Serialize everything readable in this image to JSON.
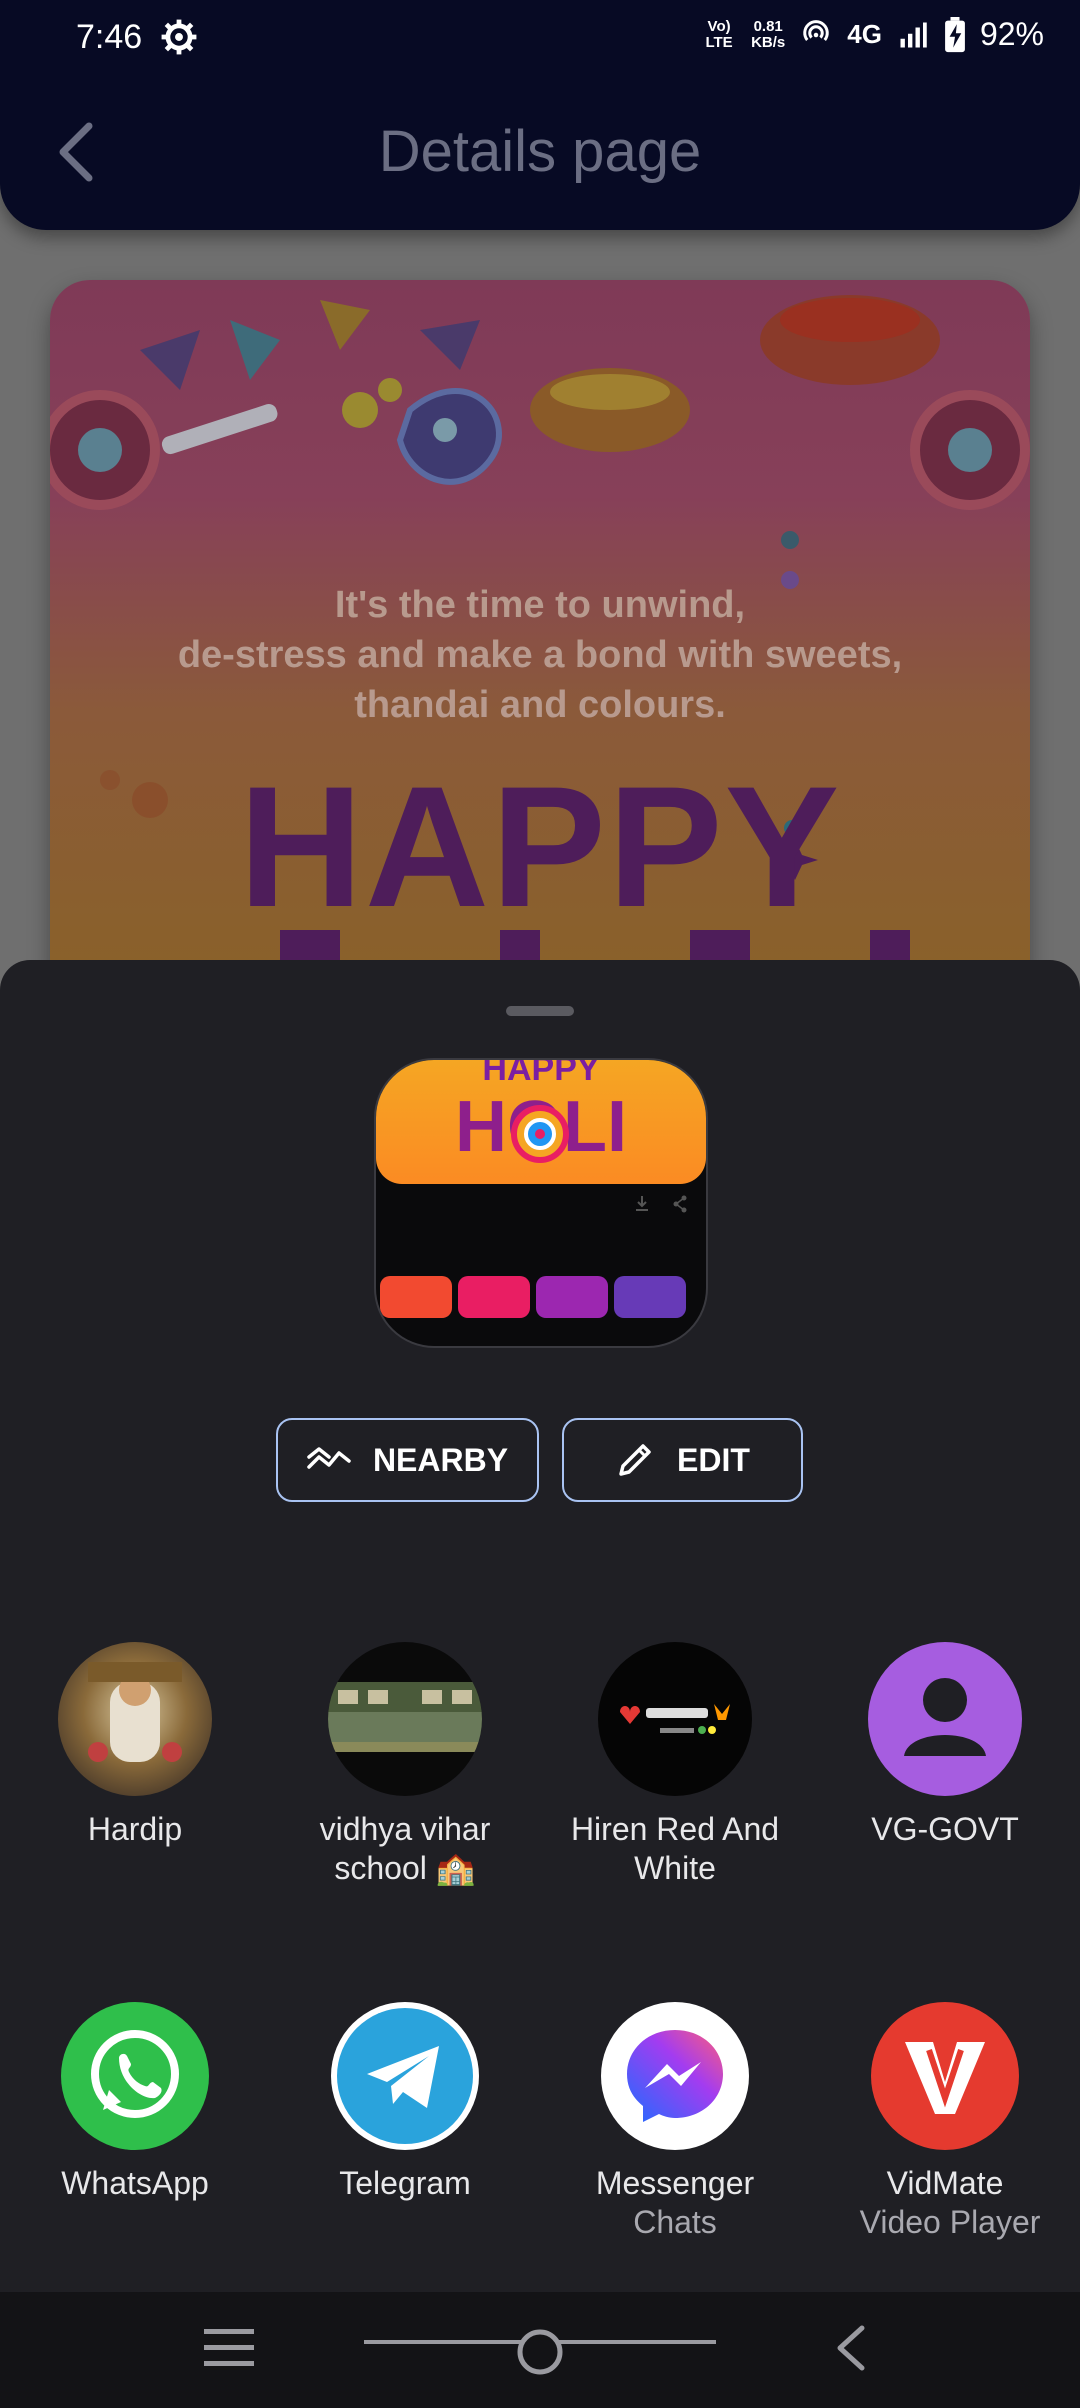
{
  "status_bar": {
    "time": "7:46",
    "network_speed_value": "0.81",
    "network_speed_unit": "KB/s",
    "volte": "Vo) LTE",
    "network_type": "4G",
    "battery": "92%"
  },
  "app_bar": {
    "title": "Details page"
  },
  "hero_card": {
    "quote_line1": "It's the time to unwind,",
    "quote_line2": "de-stress and make a bond with sweets,",
    "quote_line3": "thandai and colours.",
    "headline": "HAPPY"
  },
  "share_sheet": {
    "preview": {
      "word_top": "HAPPY",
      "word_bottom": "HOLI",
      "swatches": [
        "#f24a30",
        "#e91e63",
        "#9c27b0",
        "#673ab7"
      ]
    },
    "buttons": {
      "nearby": "NEARBY",
      "edit": "EDIT"
    },
    "contacts": [
      {
        "label": "Hardip",
        "icon": "contact-photo-deity-icon"
      },
      {
        "label": "vidhya vihar school 🏫",
        "icon": "contact-photo-school-icon"
      },
      {
        "label": "Hiren Red And White",
        "icon": "contact-photo-mom-dad-icon"
      },
      {
        "label": "VG-GOVT",
        "icon": "person-icon"
      }
    ],
    "apps": [
      {
        "label": "WhatsApp",
        "sub": "",
        "icon": "whatsapp-icon"
      },
      {
        "label": "Telegram",
        "sub": "",
        "icon": "telegram-icon"
      },
      {
        "label": "Messenger",
        "sub": "Chats",
        "icon": "messenger-icon"
      },
      {
        "label": "VidMate",
        "sub": "Video Player",
        "icon": "vidmate-icon"
      }
    ]
  },
  "colors": {
    "app_bar_bg": "#070a24",
    "sheet_bg": "#1f1f24",
    "button_outline": "#a9c3f2",
    "whatsapp": "#2fbf4b",
    "telegram": "#2aa3dc",
    "vidmate": "#e53a2f",
    "contact_default": "#a65de0"
  }
}
